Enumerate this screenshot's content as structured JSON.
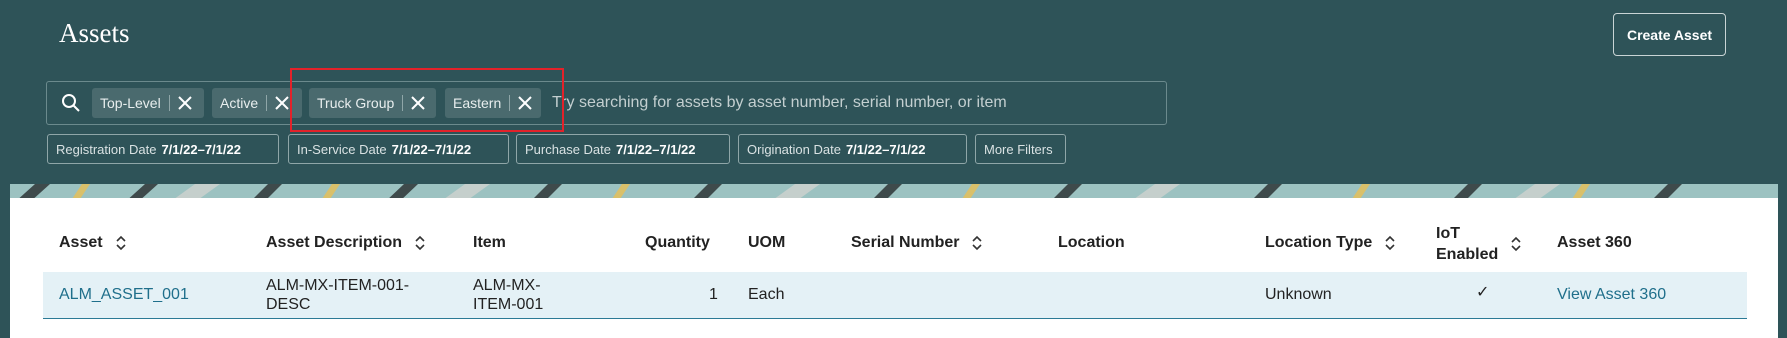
{
  "page": {
    "title": "Assets",
    "create_label": "Create Asset"
  },
  "search": {
    "placeholder": "Try searching for assets by asset number, serial number, or item",
    "chips": [
      "Top-Level",
      "Active",
      "Truck Group",
      "Eastern"
    ]
  },
  "filters": [
    {
      "label": "Registration Date",
      "value": "7/1/22–7/1/22"
    },
    {
      "label": "In-Service Date",
      "value": "7/1/22–7/1/22"
    },
    {
      "label": "Purchase Date",
      "value": "7/1/22–7/1/22"
    },
    {
      "label": "Origination Date",
      "value": "7/1/22–7/1/22"
    }
  ],
  "more_filters": "More Filters",
  "table": {
    "headers": [
      "Asset",
      "Asset Description",
      "Item",
      "Quantity",
      "UOM",
      "Serial Number",
      "Location",
      "Location Type",
      "IoT",
      "Enabled",
      "Asset 360"
    ],
    "rows": [
      {
        "asset": "ALM_ASSET_001",
        "desc_l1": "ALM-MX-ITEM-001-",
        "desc_l2": "DESC",
        "item_l1": "ALM-MX-",
        "item_l2": "ITEM-001",
        "quantity": "1",
        "uom": "Each",
        "serial": "",
        "location": "",
        "location_type": "Unknown",
        "iot": "✓",
        "asset360": "View Asset 360"
      }
    ]
  },
  "colors": {
    "background": "#2e5358",
    "link": "#1f6f8b",
    "highlight": "#e3222a"
  }
}
